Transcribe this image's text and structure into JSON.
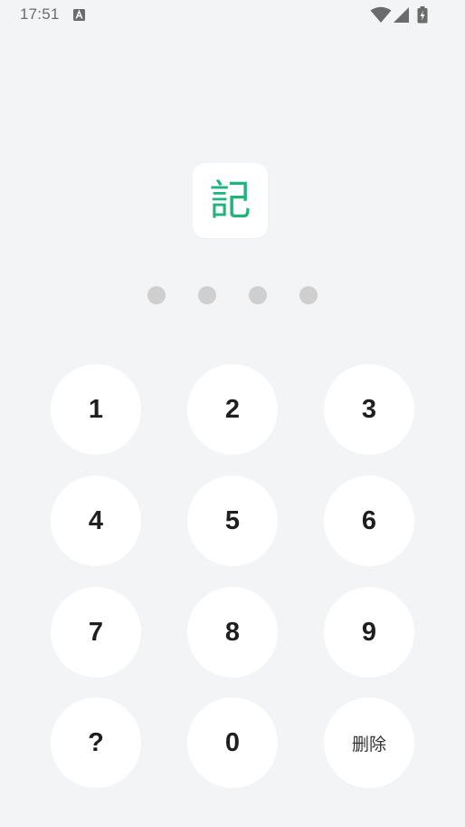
{
  "status_bar": {
    "time": "17:51",
    "notification_icon": "a-box-icon",
    "wifi_icon": "wifi-icon",
    "signal_icon": "signal-icon",
    "battery_icon": "battery-charging-icon"
  },
  "logo": {
    "char": "記",
    "color": "#1fb47c"
  },
  "pin": {
    "digits_entered": 0,
    "length": 4
  },
  "keypad": {
    "keys": [
      "1",
      "2",
      "3",
      "4",
      "5",
      "6",
      "7",
      "8",
      "9",
      "?",
      "0",
      "删除"
    ]
  }
}
